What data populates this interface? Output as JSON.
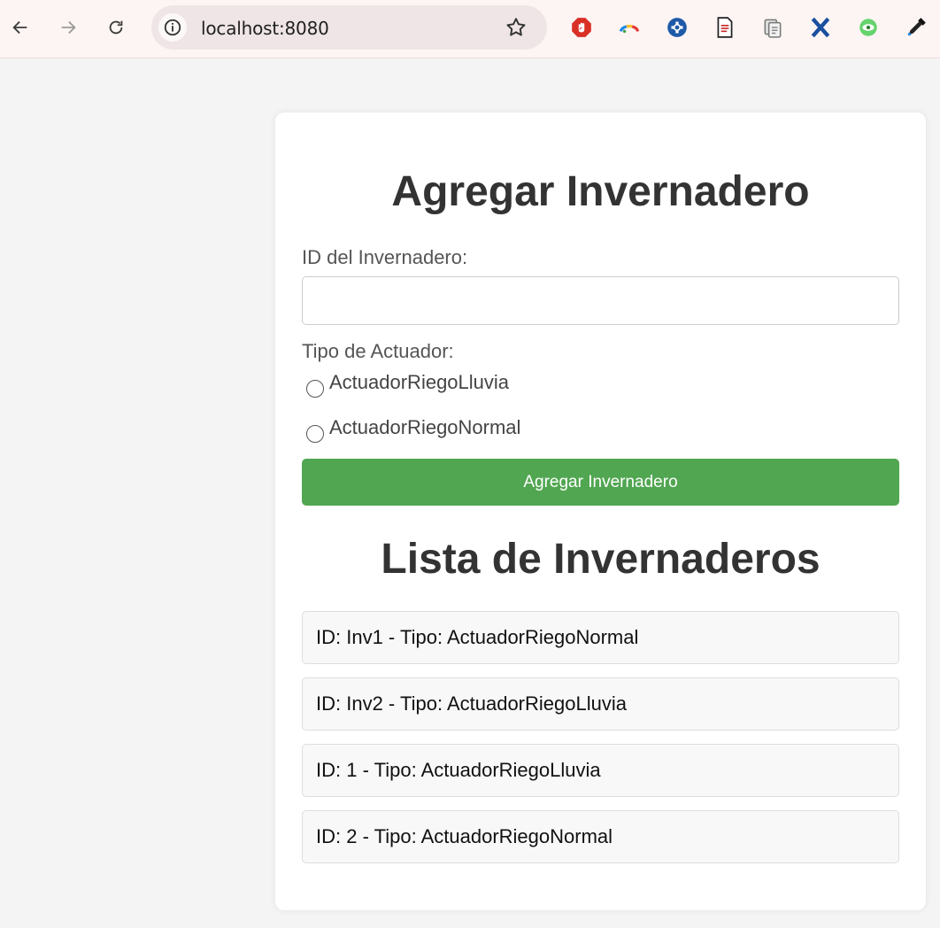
{
  "browser": {
    "url": "localhost:8080",
    "icons": [
      "back-arrow-icon",
      "forward-arrow-icon",
      "reload-icon",
      "info-icon",
      "bookmark-star-icon"
    ],
    "extensions": [
      "adblock-icon",
      "rainbow-arc-icon",
      "blue-plus-icon",
      "pdf-document-icon",
      "clipboard-icon",
      "blue-x-icon",
      "green-eye-icon",
      "color-picker-icon"
    ]
  },
  "form": {
    "title": "Agregar Invernadero",
    "id_label": "ID del Invernadero:",
    "id_value": "",
    "tipo_label": "Tipo de Actuador:",
    "options": [
      "ActuadorRiegoLluvia",
      "ActuadorRiegoNormal"
    ],
    "submit_label": "Agregar Invernadero"
  },
  "list": {
    "title": "Lista de Invernaderos",
    "items": [
      "ID: Inv1 - Tipo: ActuadorRiegoNormal",
      "ID: Inv2 - Tipo: ActuadorRiegoLluvia",
      "ID: 1 - Tipo: ActuadorRiegoLluvia",
      "ID: 2 - Tipo: ActuadorRiegoNormal"
    ]
  },
  "colors": {
    "button": "#51a651",
    "page_bg": "#f4f4f4",
    "card_bg": "#ffffff",
    "toolbar_bg": "#fdf5f3"
  }
}
